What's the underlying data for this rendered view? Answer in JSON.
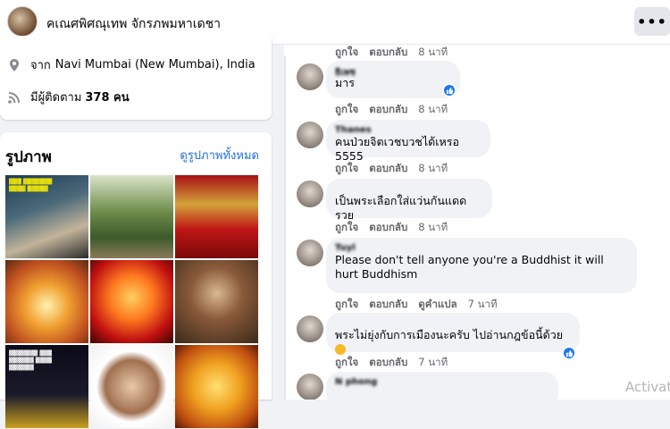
{
  "header": {
    "page_name": "คเณศพิศณุเทพ จักรภพมหาเดชา",
    "more_label": "•••"
  },
  "about": {
    "location_prefix": "จาก",
    "location": "Navi Mumbai (New Mumbai), India",
    "followers_prefix": "มีผู้ติดตาม",
    "followers_count": "378 คน"
  },
  "photos": {
    "title": "รูปภาพ",
    "see_all": "ดูรูปภาพทั้งหมด"
  },
  "comment_actions": {
    "like": "ถูกใจ",
    "reply": "ตอบกลับ",
    "translate": "ดูคำแปล"
  },
  "comments": [
    {
      "name": "",
      "text": "",
      "time": "8 นาที"
    },
    {
      "name": "ธิเพช",
      "text": "มาร",
      "time": "8 นาที",
      "reacted": true
    },
    {
      "name": "Thanes",
      "text": "คนป่วยจิตเวชบวชได้เหรอ 5555",
      "time": "8 นาที"
    },
    {
      "name": "",
      "text": "เป็นพระเลือกใส่แว่นกันแดด รวย",
      "time": "8 นาที"
    },
    {
      "name": "Tuyl",
      "text": "Please don't tell anyone you're a Buddhist it will hurt Buddhism",
      "time": "7 นาที",
      "translate": true
    },
    {
      "name": "",
      "text": "พระไม่ยุ่งกับการเมืองนะครับ ไปอ่านกฎข้อนี้ด้วย",
      "time": "7 นาที",
      "reacted": true
    },
    {
      "name": "N phong",
      "text": "",
      "time": ""
    }
  ],
  "watermark": "Activat"
}
